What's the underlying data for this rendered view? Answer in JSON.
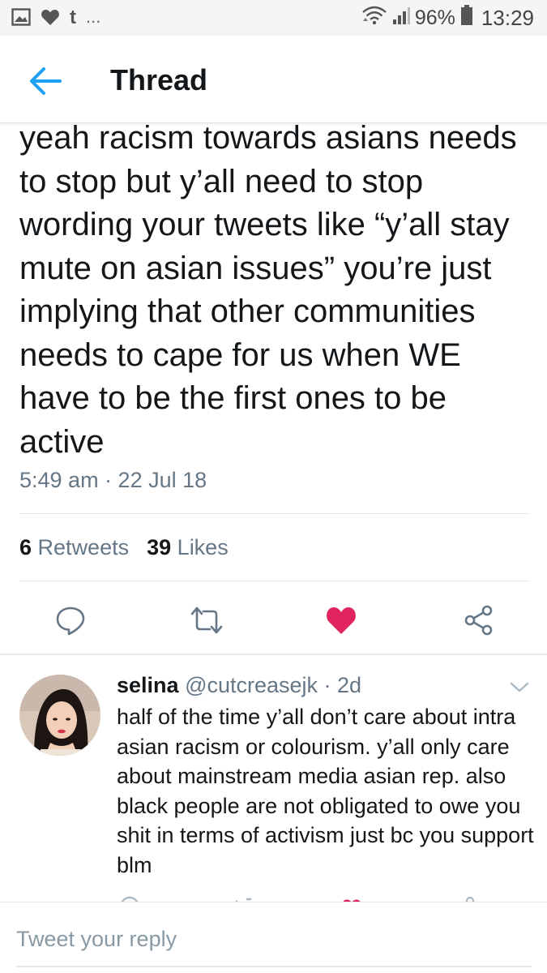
{
  "status_bar": {
    "icons_left": [
      "image-icon",
      "heart-icon",
      "tumblr-t-icon",
      "more-dots-icon"
    ],
    "tumblr_glyph": "t",
    "more_glyph": "...",
    "battery_percent": "96%",
    "time": "13:29"
  },
  "header": {
    "title": "Thread"
  },
  "tweet": {
    "text": "yeah racism towards asians needs to stop but y’all need to stop wording your tweets like “y’all stay mute on asian issues” you’re just implying that other communities needs to cape for us when WE have to be the first ones to be active",
    "timestamp": "5:49 am · 22 Jul 18",
    "retweets_count": "6",
    "retweets_label": "Retweets",
    "likes_count": "39",
    "likes_label": "Likes",
    "liked": true
  },
  "reply": {
    "name": "selina",
    "handle": "@cutcreasejk",
    "time": "· 2d",
    "text": "half of the time y’all don’t care about intra asian racism or colourism. y’all only care about mainstream media asian rep. also black people are not obligated to owe you shit in terms of activism just bc you support blm"
  },
  "reply_box": {
    "placeholder": "Tweet your reply"
  },
  "colors": {
    "accent": "#1da1f2",
    "like": "#e0245e",
    "icon_gray": "#657786",
    "text": "#14171a"
  }
}
